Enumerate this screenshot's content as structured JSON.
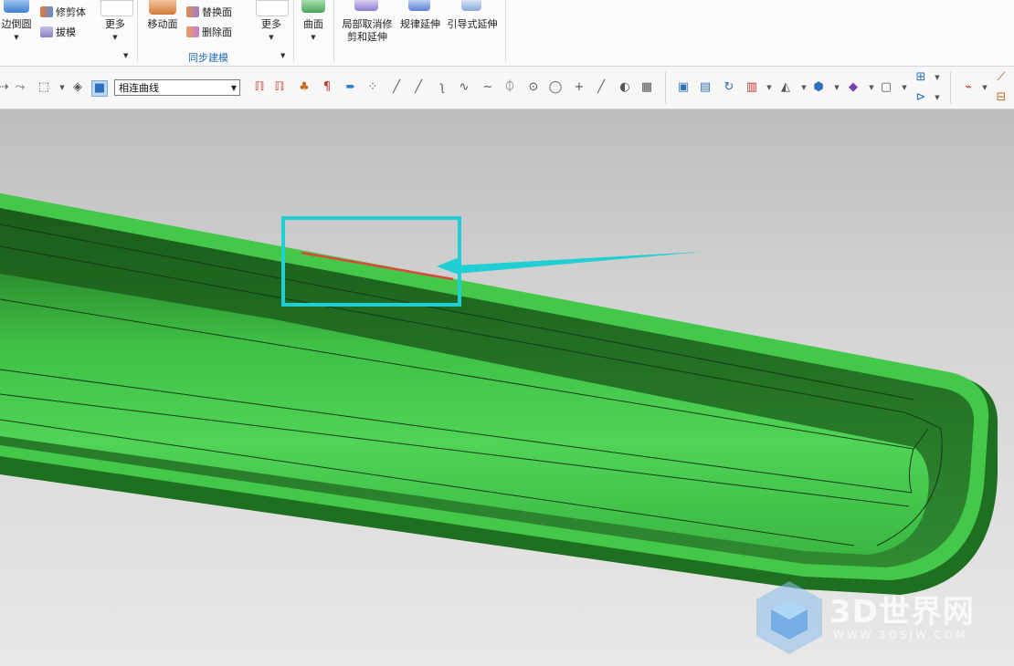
{
  "ribbon": {
    "buttons": {
      "edge_blend": "边倒圆",
      "trim_body": "修剪体",
      "draft": "拔模",
      "more1": "更多",
      "move_face": "移动面",
      "replace_face": "替换面",
      "delete_face": "删除面",
      "more2": "更多",
      "surface": "曲面",
      "local_untrim_line1": "局部取消修",
      "local_untrim_line2": "剪和延伸",
      "law_extension": "规律延伸",
      "guided_extension": "引导式延伸"
    },
    "groups": {
      "sync_modeling": "同步建模"
    }
  },
  "toolbar": {
    "curve_rule": "相连曲线"
  },
  "watermark": {
    "brand": "3D世界网",
    "url": "WWW.3DSJW.COM"
  },
  "colors": {
    "part_green": "#3fbf44",
    "part_dark": "#1c6a1c",
    "highlight_box": "#1fcfd4",
    "selected_edge": "#e0463c",
    "ribbon_label_blue": "#1f6fb3"
  }
}
